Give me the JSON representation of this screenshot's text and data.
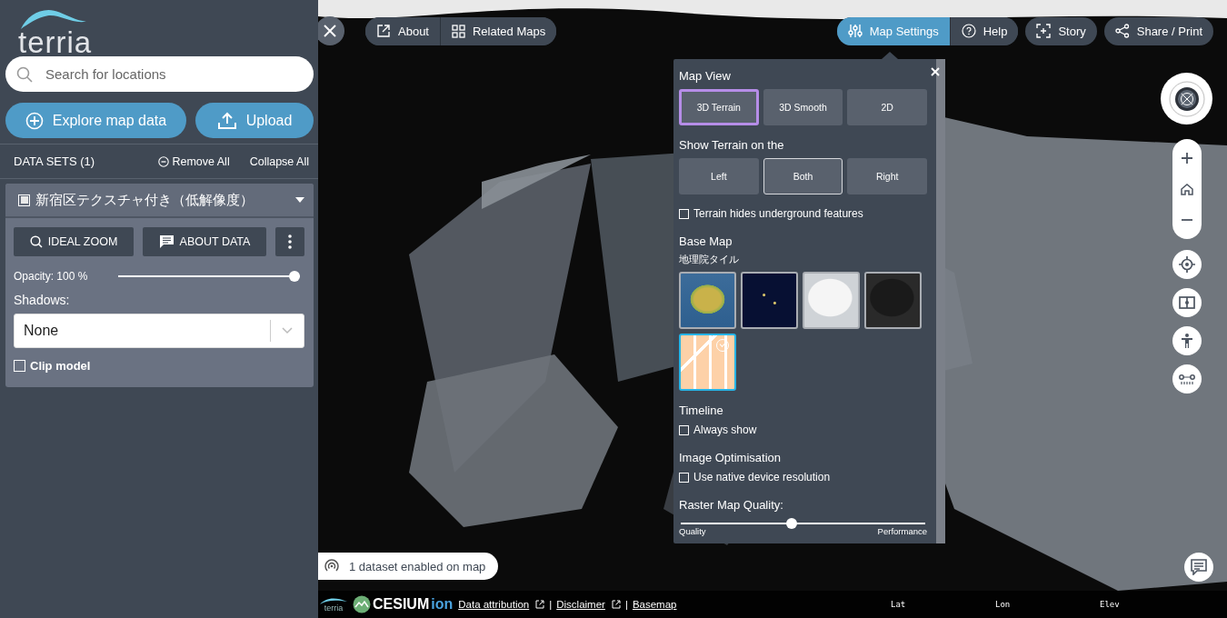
{
  "sidebar": {
    "logo_text": "terria",
    "search": {
      "placeholder": "Search for locations"
    },
    "buttons": [
      {
        "label": "Explore map data",
        "kind": "explore"
      },
      {
        "label": "Upload",
        "kind": "upload"
      }
    ],
    "data_sets": {
      "heading": "DATA SETS (1)",
      "remove_all": "Remove All",
      "collapse_all": "Collapse All"
    },
    "dataset": {
      "title": "新宿区テクスチャ付き（低解像度）",
      "checked": true,
      "expanded": true,
      "actions": [
        {
          "label": "IDEAL ZOOM",
          "kind": "zoom"
        },
        {
          "label": "ABOUT DATA",
          "kind": "about"
        },
        {
          "kind": "more"
        }
      ],
      "opacity": {
        "label": "Opacity: 100 %",
        "level": 1
      },
      "shadows": {
        "label": "Shadows:",
        "value": "None"
      },
      "clip_model": {
        "label": "Clip model",
        "checked": false
      }
    }
  },
  "toolbar_left": [
    {
      "label": "About",
      "kind": "about"
    },
    {
      "label": "Related Maps",
      "kind": "related"
    }
  ],
  "toolbar_right": [
    {
      "label": "Map Settings",
      "kind": "settings",
      "selected": true
    },
    {
      "label": "Help",
      "kind": "help",
      "selected": false
    },
    {
      "label": "Story",
      "kind": "story",
      "selected": false
    },
    {
      "label": "Share / Print",
      "kind": "share",
      "selected": false
    }
  ],
  "map_settings": {
    "map_view": {
      "heading": "Map View",
      "options": [
        {
          "label": "3D Terrain",
          "selected": true
        },
        {
          "label": "3D Smooth",
          "selected": false
        },
        {
          "label": "2D",
          "selected": false
        }
      ]
    },
    "terrain_side": {
      "heading": "Show Terrain on the",
      "options": [
        {
          "label": "Left",
          "selected": false
        },
        {
          "label": "Both",
          "selected": true
        },
        {
          "label": "Right",
          "selected": false
        }
      ]
    },
    "terrain_hides": {
      "label": "Terrain hides underground features",
      "checked": false
    },
    "base_map": {
      "heading": "Base Map",
      "current": "地理院タイル",
      "options": [
        {
          "kind": "terrain",
          "selected": false
        },
        {
          "kind": "night",
          "selected": false
        },
        {
          "kind": "light",
          "selected": false
        },
        {
          "kind": "dark",
          "selected": false
        },
        {
          "kind": "street",
          "selected": true
        }
      ]
    },
    "timeline": {
      "heading": "Timeline",
      "label": "Always show",
      "checked": false
    },
    "image_optimisation": {
      "heading": "Image Optimisation",
      "label": "Use native device resolution",
      "checked": false
    },
    "raster_quality": {
      "heading": "Raster Map Quality:",
      "min_label": "Quality",
      "max_label": "Performance",
      "level": 0.45
    }
  },
  "status": {
    "label": "1 dataset enabled on map"
  },
  "footer": {
    "logo_text": "terria",
    "brand": "CESIUM",
    "brand_suffix": "ion",
    "credits": [
      {
        "kind": "link",
        "label": "Data attribution",
        "external": true
      },
      {
        "kind": "separator",
        "label": "|"
      },
      {
        "kind": "link",
        "label": "Disclaimer",
        "external": true
      },
      {
        "kind": "separator",
        "label": "|"
      },
      {
        "kind": "link",
        "label": "Basemap",
        "external": false
      }
    ],
    "coordinates": [
      "Lat",
      "Lon",
      "Elev"
    ]
  }
}
